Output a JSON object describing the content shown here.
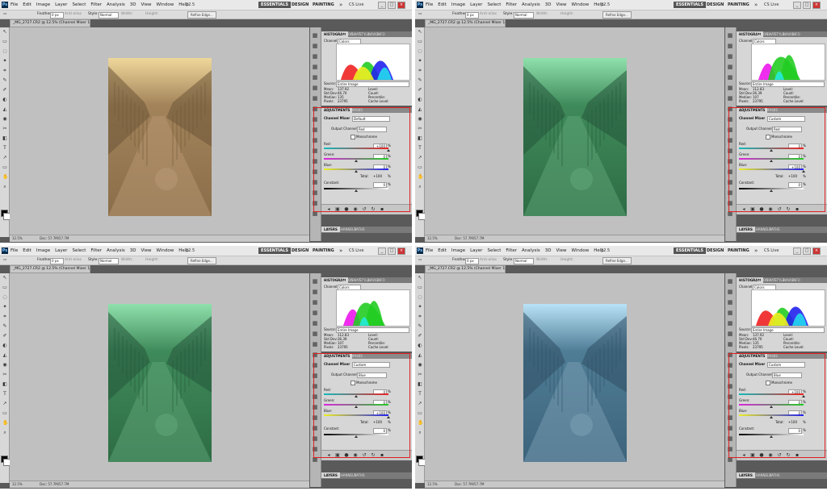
{
  "app": {
    "logo": "Ps",
    "menu": [
      "File",
      "Edit",
      "Image",
      "Layer",
      "Select",
      "Filter",
      "Analysis",
      "3D",
      "View",
      "Window",
      "Help"
    ],
    "zoom_menu": "12.5",
    "workspaces": [
      "ESSENTIALS",
      "DESIGN",
      "PAINTING"
    ],
    "overflow": "»",
    "cs_live": "CS Live",
    "win_buttons": [
      "_",
      "□",
      "×"
    ]
  },
  "options": {
    "feather_label": "Feather:",
    "feather_value": "0 px",
    "antialias": "Anti-alias",
    "style_label": "Style:",
    "style_value": "Normal",
    "width_label": "Width:",
    "height_label": "Height:",
    "refine_button": "Refine Edge..."
  },
  "document": {
    "tab_title": "_MG_2727.CR2 @ 12.5% (Channel Mixer 1, Layer Mask/16) *",
    "zoom": "12.5%",
    "doc_size": "Doc: 57.7M/57.7M"
  },
  "histogram": {
    "tabs": [
      "HISTOGRAM",
      "COLOR",
      "SWAT",
      "STYLE",
      "NAVIG",
      "INFO"
    ],
    "channel_label": "Channel:",
    "channel_value": "Colors",
    "source_label": "Source:",
    "source_value": "Entire Image",
    "stats_left": [
      "Mean:",
      "Std Dev:",
      "Median:",
      "Pixels:"
    ],
    "stats_right": [
      "Level:",
      "Count:",
      "Percentile:",
      "Cache Level:"
    ]
  },
  "adjustments": {
    "tabs": [
      "ADJUSTMENTS",
      "MASKS"
    ],
    "title": "Channel Mixer",
    "output_label": "Output Channel:",
    "monochrome": "Monochrome",
    "red_label": "Red:",
    "green_label": "Green:",
    "blue_label": "Blue:",
    "total_label": "Total:",
    "constant_label": "Constant:",
    "pct": "%"
  },
  "layers_tabs": [
    "LAYERS",
    "CHANNELS",
    "PATHS"
  ],
  "panes": [
    {
      "preset": "Default",
      "output": "Red",
      "red": "+100",
      "green": "0",
      "blue": "0",
      "total": "+100",
      "constant": "0",
      "red_level": 1.0,
      "green_level": 0.5,
      "blue_level": 0.5,
      "constant_level": 0.5,
      "mean": "137.92",
      "stddev": "46.70",
      "median": "135",
      "pixels": "23795",
      "tint": "sepia"
    },
    {
      "preset": "Custom",
      "output": "Red",
      "red": "0",
      "green": "0",
      "blue": "+100",
      "total": "+100",
      "constant": "0",
      "red_level": 0.5,
      "green_level": 0.5,
      "blue_level": 1.0,
      "constant_level": 0.5,
      "mean": "112.83",
      "stddev": "36.39",
      "median": "107",
      "pixels": "23795",
      "tint": "green"
    },
    {
      "preset": "Custom",
      "output": "Blue",
      "red": "0",
      "green": "0",
      "blue": "+100",
      "total": "+100",
      "constant": "0",
      "red_level": 0.5,
      "green_level": 0.5,
      "blue_level": 1.0,
      "constant_level": 0.5,
      "mean": "112.83",
      "stddev": "36.39",
      "median": "107",
      "pixels": "23795",
      "tint": "green"
    },
    {
      "preset": "Custom",
      "output": "Blue",
      "red": "+100",
      "green": "0",
      "blue": "0",
      "total": "+100",
      "constant": "0",
      "red_level": 1.0,
      "green_level": 0.5,
      "blue_level": 0.5,
      "constant_level": 0.5,
      "mean": "137.92",
      "stddev": "46.70",
      "median": "135",
      "pixels": "23795",
      "tint": "blue"
    }
  ],
  "colors": {
    "highlight": "#e02020",
    "workspace_active": "#555555",
    "canvas": "#c0c0c0"
  }
}
